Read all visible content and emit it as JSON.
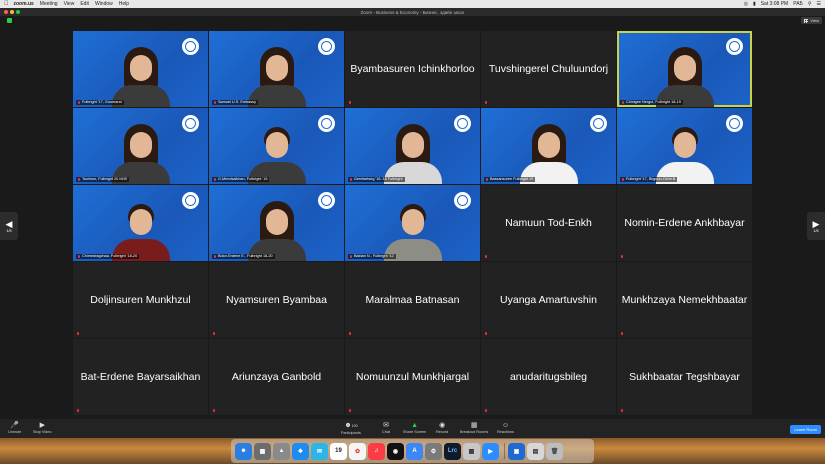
{
  "menubar": {
    "app": "zoom.us",
    "items": [
      "Meeting",
      "View",
      "Edit",
      "Window",
      "Help"
    ],
    "clock": "Sat 3:08 PM",
    "input": "РАБ"
  },
  "window": {
    "title": "Zoom - Business & Economy - Бизнес, эдийн засаг",
    "view_label": "View"
  },
  "nav": {
    "page_left": "1/5",
    "page_right": "1/5"
  },
  "tiles": [
    {
      "type": "video",
      "caption": "Fulbright '17, Goomaral",
      "look": "dark"
    },
    {
      "type": "video",
      "caption": "Samuel U.S. Embassy",
      "look": "dark"
    },
    {
      "type": "name",
      "name": "Byambasuren Ichinkhorloo"
    },
    {
      "type": "name",
      "name": "Tuvshingerel Chuluundorj"
    },
    {
      "type": "video",
      "caption": "Chinigee Nergui, Fulbright 18-19",
      "look": "dark",
      "active": true
    },
    {
      "type": "video",
      "caption": "Tsolmon, Fulbright 20 MIIS",
      "look": "dark"
    },
    {
      "type": "video",
      "caption": "G.Mendsaikhan, Fulbright '15",
      "look": "dark"
    },
    {
      "type": "video",
      "caption": "Gerelsetseg '16-'18 Fulbright",
      "look": "light"
    },
    {
      "type": "video",
      "caption": "Bassansuren Fulbright 19",
      "look": "white"
    },
    {
      "type": "video",
      "caption": "Fulbright '17, Bilguun-Ochir.B",
      "look": "white"
    },
    {
      "type": "video",
      "caption": "Chimedragchaa, Fulbright '18-20",
      "look": "red"
    },
    {
      "type": "video",
      "caption": "Bolor-Erdene E., Fulbright 18-20",
      "look": "dark"
    },
    {
      "type": "video",
      "caption": "Baldan N., Fulbright '12",
      "look": "grey"
    },
    {
      "type": "name",
      "name": "Namuun Tod-Enkh"
    },
    {
      "type": "name",
      "name": "Nomin-Erdene Ankhbayar"
    },
    {
      "type": "name",
      "name": "Doljinsuren Munkhzul"
    },
    {
      "type": "name",
      "name": "Nyamsuren Byambaa"
    },
    {
      "type": "name",
      "name": "Maralmaa Batnasan"
    },
    {
      "type": "name",
      "name": "Uyanga Amartuvshin"
    },
    {
      "type": "name",
      "name": "Munkhzaya Nemekhbaatar"
    },
    {
      "type": "name",
      "name": "Bat-Erdene Bayarsaikhan"
    },
    {
      "type": "name",
      "name": "Ariunzaya Ganbold"
    },
    {
      "type": "name",
      "name": "Nomuunzul Munkhjargal"
    },
    {
      "type": "name",
      "name": "anudaritugsbileg"
    },
    {
      "type": "name",
      "name": "Sukhbaatar Tegshbayar"
    }
  ],
  "toolbar": {
    "unmute": "Unmute",
    "stop_video": "Stop Video",
    "participants": "Participants",
    "participants_count": "100",
    "chat": "Chat",
    "share_screen": "Share Screen",
    "record": "Record",
    "breakout_rooms": "Breakout Rooms",
    "reactions": "Reactions",
    "leave": "Leave Room"
  },
  "dock": {
    "calendar_day": "19",
    "lrc_label": "Lrc"
  },
  "colors": {
    "video_bg": "#1f6fd6",
    "active_speaker": "#c9d34a",
    "leave_button": "#2d8cff",
    "share_green": "#2ecc40"
  }
}
